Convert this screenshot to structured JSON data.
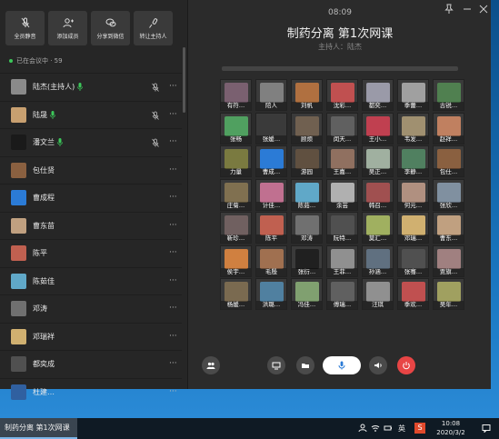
{
  "toolbar": [
    {
      "label": "全员静音",
      "icon": "mic-off-icon"
    },
    {
      "label": "添加成员",
      "icon": "add-member-icon"
    },
    {
      "label": "分享到微信",
      "icon": "wechat-icon"
    },
    {
      "label": "转让主持人",
      "icon": "transfer-host-icon"
    }
  ],
  "status": {
    "text": "已在会议中 · 59"
  },
  "participants": [
    {
      "name": "陆杰(主持人)",
      "color": "#8a8a8a",
      "speaking": true,
      "muted_icon": true
    },
    {
      "name": "陆晟",
      "color": "#c8a070",
      "speaking": true,
      "muted_icon": true
    },
    {
      "name": "潘文兰",
      "color": "#1a1a1a",
      "speaking": true,
      "muted_icon": true
    },
    {
      "name": "包仕贤",
      "color": "#8a6040",
      "speaking": false,
      "muted_icon": false
    },
    {
      "name": "曹成程",
      "color": "#2b7bd6",
      "speaking": false,
      "muted_icon": false
    },
    {
      "name": "曹东苗",
      "color": "#c0a080",
      "speaking": false,
      "muted_icon": false
    },
    {
      "name": "陈平",
      "color": "#c06050",
      "speaking": false,
      "muted_icon": false
    },
    {
      "name": "陈茹佳",
      "color": "#60a8c8",
      "speaking": false,
      "muted_icon": false
    },
    {
      "name": "邓涛",
      "color": "#707070",
      "speaking": false,
      "muted_icon": false
    },
    {
      "name": "邓瑞祥",
      "color": "#d0b070",
      "speaking": false,
      "muted_icon": false
    },
    {
      "name": "都奕成",
      "color": "#505050",
      "speaking": false,
      "muted_icon": false
    },
    {
      "name": "杜建…",
      "color": "#3060a0",
      "speaking": false,
      "muted_icon": false
    }
  ],
  "meeting": {
    "time": "08:09",
    "title": "制药分离 第1次网课",
    "host": "主持人：陆杰"
  },
  "tiles": [
    {
      "name": "有符…",
      "color": "#7a6070"
    },
    {
      "name": "陪人",
      "color": "#808080"
    },
    {
      "name": "刘帆",
      "color": "#b07040"
    },
    {
      "name": "沈彩…",
      "color": "#c05050"
    },
    {
      "name": "都奕…",
      "color": "#9a9aa8"
    },
    {
      "name": "季蕾…",
      "color": "#a0a0a0"
    },
    {
      "name": "古锐…",
      "color": "#508050"
    },
    {
      "name": "张畅",
      "color": "#50a060"
    },
    {
      "name": "张媛…",
      "color": "#3a3a3a"
    },
    {
      "name": "顾烦",
      "color": "#706050"
    },
    {
      "name": "闵天…",
      "color": "#606060"
    },
    {
      "name": "王小…",
      "color": "#c04050"
    },
    {
      "name": "韦发…",
      "color": "#a09070"
    },
    {
      "name": "赵祥…",
      "color": "#c08060"
    },
    {
      "name": "力量",
      "color": "#7a7a40"
    },
    {
      "name": "曹成…",
      "color": "#2b7bd6"
    },
    {
      "name": "游园",
      "color": "#605040"
    },
    {
      "name": "王嘉…",
      "color": "#907060"
    },
    {
      "name": "吴正…",
      "color": "#a0b0a0"
    },
    {
      "name": "李静…",
      "color": "#508060"
    },
    {
      "name": "包仕…",
      "color": "#8a6040"
    },
    {
      "name": "庄菊…",
      "color": "#807050"
    },
    {
      "name": "计佳…",
      "color": "#c07090"
    },
    {
      "name": "陈茹…",
      "color": "#60a8c8"
    },
    {
      "name": "余芸",
      "color": "#b0b0b0"
    },
    {
      "name": "韩召…",
      "color": "#a05050"
    },
    {
      "name": "何元…",
      "color": "#b09080"
    },
    {
      "name": "张欣…",
      "color": "#8090a0"
    },
    {
      "name": "靳珍…",
      "color": "#706060"
    },
    {
      "name": "陈平",
      "color": "#c06050"
    },
    {
      "name": "邓涛",
      "color": "#707070"
    },
    {
      "name": "阮特…",
      "color": "#505050"
    },
    {
      "name": "莫汇…",
      "color": "#a0b060"
    },
    {
      "name": "邓瑞…",
      "color": "#d0b070"
    },
    {
      "name": "曹东…",
      "color": "#c0a080"
    },
    {
      "name": "侯宇…",
      "color": "#d08040"
    },
    {
      "name": "毛殷",
      "color": "#a07050"
    },
    {
      "name": "张衍…",
      "color": "#202020"
    },
    {
      "name": "王菲…",
      "color": "#909090"
    },
    {
      "name": "孙涵…",
      "color": "#607080"
    },
    {
      "name": "张骞…",
      "color": "#505050"
    },
    {
      "name": "贾旗…",
      "color": "#a08080"
    },
    {
      "name": "杨媛…",
      "color": "#7a6a50"
    },
    {
      "name": "洪璐…",
      "color": "#5080a0"
    },
    {
      "name": "冯佳…",
      "color": "#80a070"
    },
    {
      "name": "傅瑞…",
      "color": "#606060"
    },
    {
      "name": "汪琪",
      "color": "#909090"
    },
    {
      "name": "季欢…",
      "color": "#c05050"
    },
    {
      "name": "吴年…",
      "color": "#a0a060"
    }
  ],
  "taskbar": {
    "app": "制药分离 第1次网课",
    "ime": "英",
    "clock_time": "10:08",
    "clock_date": "2020/3/2"
  }
}
